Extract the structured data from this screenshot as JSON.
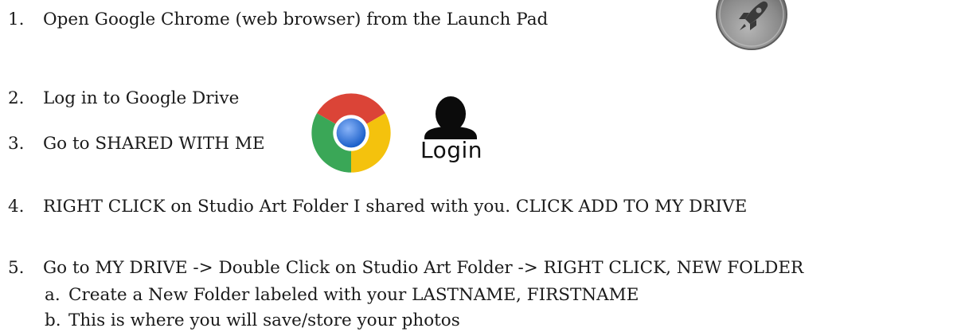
{
  "steps": [
    {
      "num": "1.",
      "text": "Open Google Chrome (web browser) from the Launch Pad"
    },
    {
      "num": "2.",
      "text": "Log in to Google Drive"
    },
    {
      "num": "3.",
      "text": "Go to SHARED WITH ME"
    },
    {
      "num": "4.",
      "text": "RIGHT CLICK on Studio Art Folder I shared with you. CLICK ADD TO MY DRIVE"
    },
    {
      "num": "5.",
      "text": "Go to MY DRIVE -> Double Click on Studio Art Folder -> RIGHT CLICK, NEW FOLDER",
      "substeps": [
        {
          "num": "a.",
          "text": "Create a New Folder labeled with your LASTNAME, FIRSTNAME"
        },
        {
          "num": "b.",
          "text": "This is where you will save/store your photos"
        }
      ]
    }
  ],
  "icons": {
    "launchpad": "launchpad-icon",
    "chrome": "chrome-icon",
    "login": "user-login-icon"
  },
  "login_label": "Login",
  "colors": {
    "text": "#1a1a1a",
    "chrome_red": "#db4437",
    "chrome_yellow": "#f4c20d",
    "chrome_green": "#3aa757",
    "chrome_blue": "#4285f4",
    "launchpad_gray": "#8c8c8c"
  }
}
